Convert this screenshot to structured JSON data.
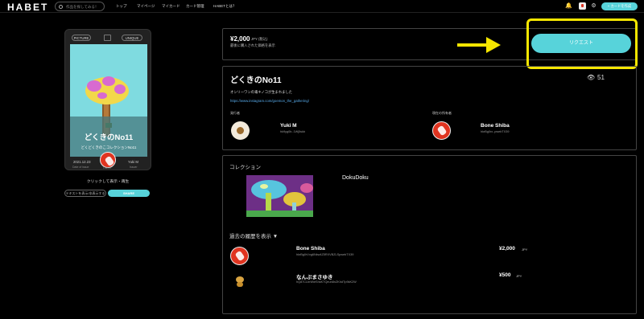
{
  "header": {
    "logo": "HABET",
    "search_placeholder": "作品を探してみる！",
    "nav": [
      "トップ",
      "マイページ",
      "マイカード",
      "カード管理",
      "HABETとは？"
    ],
    "create_button": "+ カードを作成"
  },
  "card": {
    "pill_left": "PICTURE",
    "pill_right": "UNIQUE",
    "title": "どくきのNo11",
    "subtitle": "どくどくきのこコレクションNo11",
    "date": "2021.12.23",
    "date_label": "Date of issue",
    "owner_label": "Owner",
    "issuer": "Yuki M",
    "issuer_label": "Issuer",
    "click_text": "クリックして表示・再生",
    "text_button": "テキストを表示/非表示する",
    "share_button": "SHARE"
  },
  "price": {
    "amount": "¥2,000",
    "unit": "JPY (税込)",
    "note": "最後に購入された価格を表示",
    "request_button": "リクエスト"
  },
  "detail": {
    "title": "どくきのNo11",
    "views": "51",
    "description": "オンリーワンの毒キノコが生まれました",
    "link": "https://www.instagram.com/goemon_the_gathering/",
    "issuer_label": "発行者",
    "issuer_name": "Yuki M",
    "issuer_hash": "hk9yg0b..1Wj5skb",
    "owner_label": "現在の所有者",
    "owner_name": "Bone Shiba",
    "owner_hash": "hkrBg0rx..pwebTX39"
  },
  "collection": {
    "heading": "コレクション",
    "name": "DokuDoku"
  },
  "history": {
    "toggle": "過去の履歴を表示 ▼",
    "rows": [
      {
        "name": "Bone Shiba",
        "hash": "hkrBg0rVvg6Nkw4Z5RXVBZLSpwebTX39",
        "price": "¥2,000",
        "unit": "JPY"
      },
      {
        "name": "なんぶまさゆき",
        "hash": "hQ87CLbrWieShkKTQeuh8nZKhdTp9kK2W",
        "price": "¥500",
        "unit": "JPY"
      }
    ]
  },
  "colors": {
    "accent": "#57d3da",
    "highlight": "#f5e600",
    "card_bg": "#7fdbe0"
  }
}
